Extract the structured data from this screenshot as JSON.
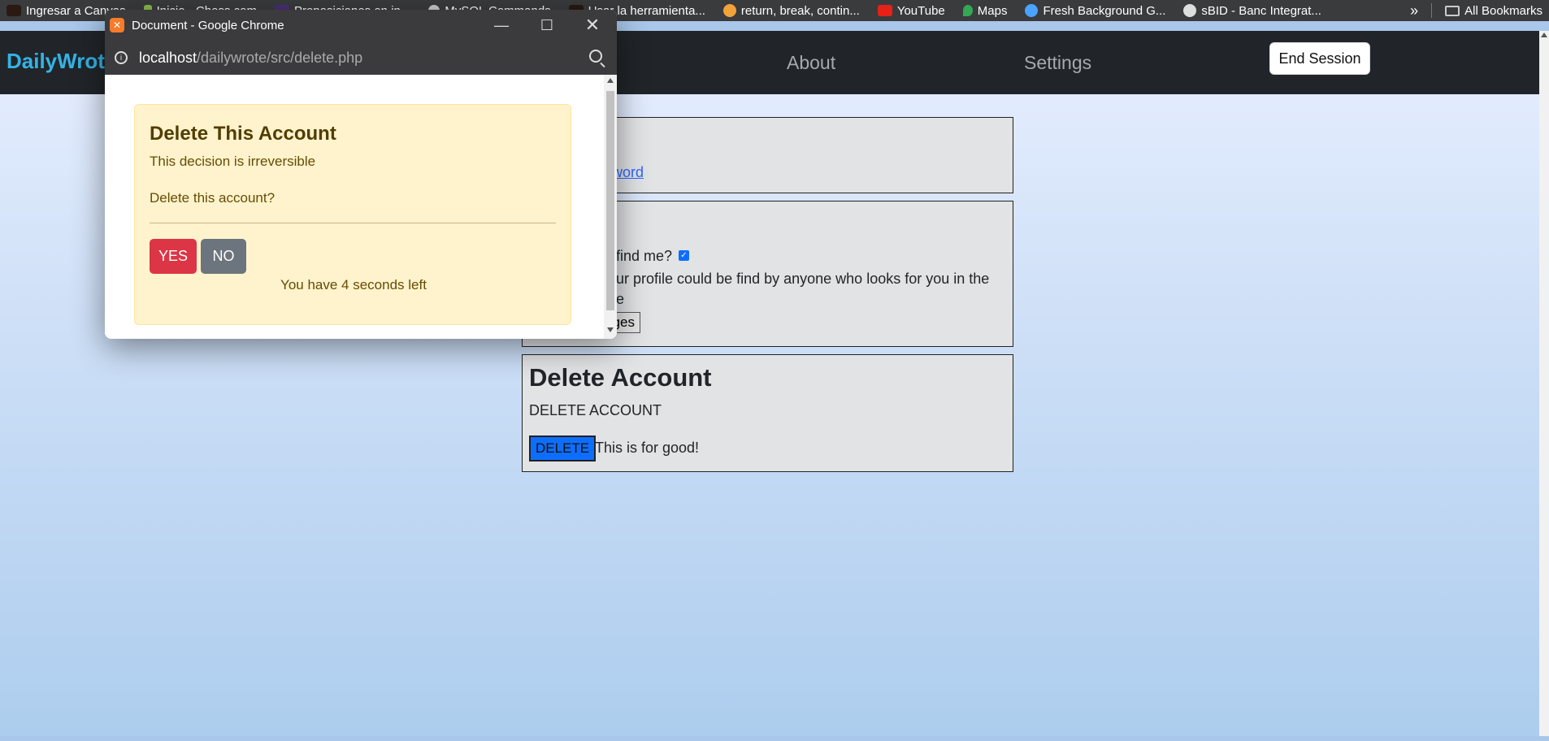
{
  "bookmarks": {
    "items": [
      {
        "label": "Ingresar a Canvas",
        "color": "#2a1a12"
      },
      {
        "label": "Inicio - Chess.com",
        "color": "#8bbf4a"
      },
      {
        "label": "Proposiciones en in...",
        "color": "#4b2f7a"
      },
      {
        "label": "MySQL Commands",
        "color": "#cccccc"
      },
      {
        "label": "Usar la herramienta...",
        "color": "#2a1a12"
      },
      {
        "label": "return, break, contin...",
        "color": "#f2a23a"
      },
      {
        "label": "YouTube",
        "color": "#e62117"
      },
      {
        "label": "Maps",
        "color": "#34a853"
      },
      {
        "label": "Fresh Background G...",
        "color": "#4aa3ff"
      },
      {
        "label": "sBID - Banc Integrat...",
        "color": "#dddddd"
      }
    ],
    "more_label": "»",
    "all_bookmarks_label": "All Bookmarks"
  },
  "navbar": {
    "brand": "DailyWrote",
    "about": "About",
    "settings": "Settings",
    "end_session": "End Session"
  },
  "cards": {
    "privacy_title": "y",
    "change_password_link": "word",
    "profile_title": "",
    "find_me_label": "find me?",
    "find_me_desc_line1": "ur profile could be find by anyone who looks for you in the",
    "find_me_desc_line2": "e",
    "save_changes": "ges",
    "delete_title": "Delete Account",
    "delete_text": "DELETE ACCOUNT",
    "delete_button": "DELETE",
    "delete_note": "This is for good!"
  },
  "popup": {
    "window_title": "Document - Google Chrome",
    "url_host": "localhost",
    "url_path": "/dailywrote/src/delete.php",
    "alert_title": "Delete This Account",
    "alert_text1": "This decision is irreversible",
    "alert_text2": "Delete this account?",
    "yes": "YES",
    "no": "NO",
    "countdown": "You have 4 seconds left"
  }
}
